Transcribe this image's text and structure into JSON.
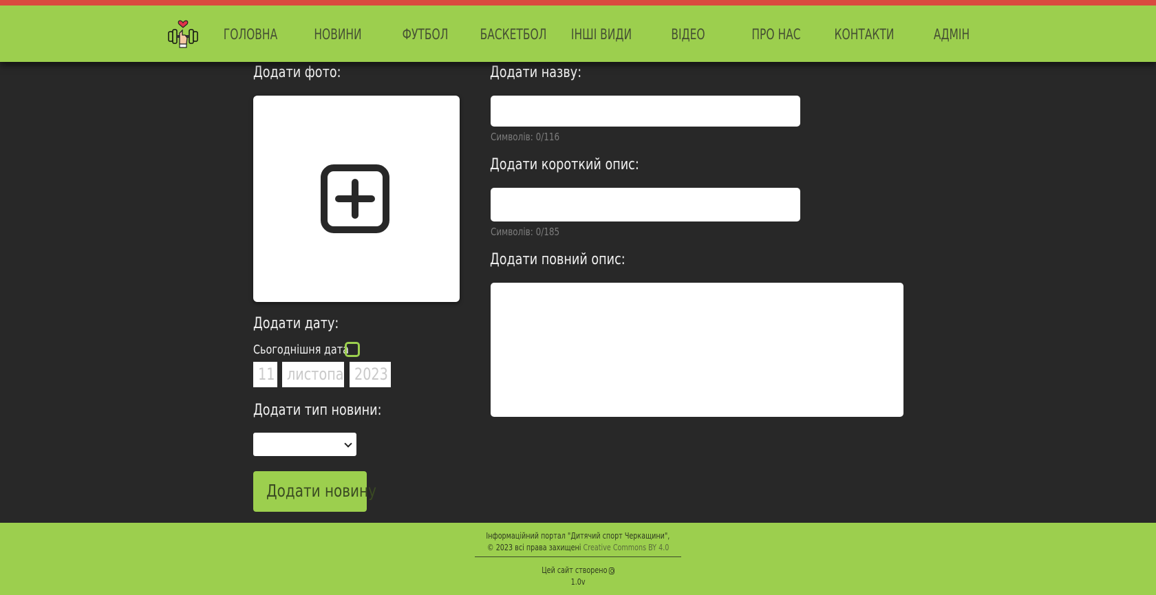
{
  "colors": {
    "accent": "#9ccf4e",
    "topStripe": "#d94a3f",
    "background": "#282828",
    "navText": "#454f33"
  },
  "header": {
    "logo_icon": "dumbbell-heart-icon",
    "nav": [
      {
        "label": "ГОЛОВНА"
      },
      {
        "label": "НОВИНИ"
      },
      {
        "label": "ФУТБОЛ"
      },
      {
        "label": "БАСКЕТБОЛ"
      },
      {
        "label": "ІНШІ ВИДИ"
      },
      {
        "label": "ВІДЕО"
      },
      {
        "label": "ПРО НАС"
      },
      {
        "label": "КОНТАКТИ"
      },
      {
        "label": "АДМІН"
      }
    ]
  },
  "form": {
    "photo": {
      "label": "Додати фото:",
      "icon": "plus-square-icon"
    },
    "title": {
      "label": "Додати назву:",
      "value": "",
      "counter": "Символів: 0/116"
    },
    "short_desc": {
      "label": "Додати короткий опис:",
      "value": "",
      "counter": "Символів: 0/185"
    },
    "full_desc": {
      "label": "Додати повний опис:",
      "value": ""
    },
    "date": {
      "label": "Додати дату:",
      "today_label": "Сьогоднішня дата",
      "today_checked": false,
      "day_placeholder": "11",
      "month_placeholder": "листопад",
      "year_placeholder": "2023"
    },
    "type": {
      "label": "Додати тип новини:",
      "selected": ""
    },
    "submit_label": "Додати новину"
  },
  "footer": {
    "line1": "Інформаційний портал \"Дитячий спорт Черкащини\",",
    "line2_prefix": "© 2023 всі права захищені ",
    "license_link": "Creative Commons BY 4.0",
    "made_by": "Цей сайт створено",
    "made_by_icon": "instagram-icon",
    "version": "1.0v"
  }
}
